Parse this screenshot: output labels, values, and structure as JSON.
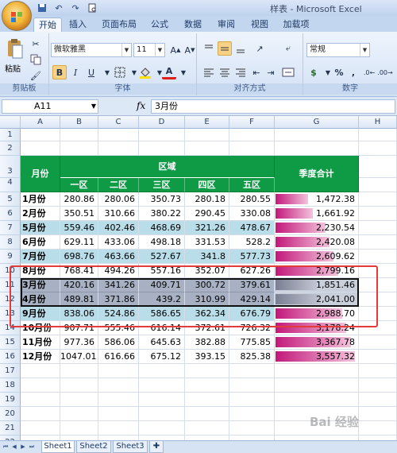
{
  "app": {
    "title": "样表 - Microsoft Excel"
  },
  "qat": {
    "save_icon": "save-icon",
    "undo_icon": "undo-icon",
    "redo_icon": "redo-icon",
    "preview_icon": "print-preview-icon"
  },
  "ribbon": {
    "tabs": [
      "开始",
      "插入",
      "页面布局",
      "公式",
      "数据",
      "审阅",
      "视图",
      "加载项"
    ],
    "groups": {
      "clipboard": "剪贴板",
      "font": "字体",
      "alignment": "对齐方式",
      "number": "数字"
    },
    "paste_label": "粘贴",
    "font_name": "微软雅黑",
    "font_size": "11",
    "number_format": "常规",
    "bold": "B",
    "italic": "I",
    "underline": "U",
    "font_color_letter": "A",
    "currency": "$",
    "percent": "%",
    "comma": ","
  },
  "formula_bar": {
    "name_box": "A11",
    "fx": "fx",
    "content": "3月份"
  },
  "sheet": {
    "columns": [
      "A",
      "B",
      "C",
      "D",
      "E",
      "F",
      "G",
      "H"
    ],
    "rows": [
      "1",
      "2",
      "3",
      "4",
      "5",
      "6",
      "7",
      "8",
      "9",
      "10",
      "11",
      "12",
      "13",
      "14",
      "15",
      "16",
      "17",
      "18",
      "19",
      "20",
      "21",
      "22"
    ],
    "header": {
      "month": "月份",
      "region": "区域",
      "total": "季度合计",
      "sub": [
        "一区",
        "二区",
        "三区",
        "四区",
        "五区"
      ]
    },
    "data": [
      {
        "month": "1月份",
        "v": [
          "280.86",
          "280.06",
          "350.73",
          "280.18",
          "280.55"
        ],
        "total": "1,472.38",
        "tv": 1472.38,
        "style": "white"
      },
      {
        "month": "2月份",
        "v": [
          "350.51",
          "310.66",
          "380.22",
          "290.45",
          "330.08"
        ],
        "total": "1,661.92",
        "tv": 1661.92,
        "style": "white"
      },
      {
        "month": "5月份",
        "v": [
          "559.46",
          "402.46",
          "468.69",
          "321.26",
          "478.67"
        ],
        "total": "2,230.54",
        "tv": 2230.54,
        "style": "blue"
      },
      {
        "month": "6月份",
        "v": [
          "629.11",
          "433.06",
          "498.18",
          "331.53",
          "528.2"
        ],
        "total": "2,420.08",
        "tv": 2420.08,
        "style": "white"
      },
      {
        "month": "7月份",
        "v": [
          "698.76",
          "463.66",
          "527.67",
          "341.8",
          "577.73"
        ],
        "total": "2,609.62",
        "tv": 2609.62,
        "style": "blue"
      },
      {
        "month": "8月份",
        "v": [
          "768.41",
          "494.26",
          "557.16",
          "352.07",
          "627.26"
        ],
        "total": "2,799.16",
        "tv": 2799.16,
        "style": "white"
      },
      {
        "month": "3月份",
        "v": [
          "420.16",
          "341.26",
          "409.71",
          "300.72",
          "379.61"
        ],
        "total": "1,851.46",
        "tv": 1851.46,
        "style": "sel"
      },
      {
        "month": "4月份",
        "v": [
          "489.81",
          "371.86",
          "439.2",
          "310.99",
          "429.14"
        ],
        "total": "2,041.00",
        "tv": 2041.0,
        "style": "sel"
      },
      {
        "month": "9月份",
        "v": [
          "838.06",
          "524.86",
          "586.65",
          "362.34",
          "676.79"
        ],
        "total": "2,988.70",
        "tv": 2988.7,
        "style": "blue"
      },
      {
        "month": "10月份",
        "v": [
          "907.71",
          "555.46",
          "616.14",
          "372.61",
          "726.32"
        ],
        "total": "3,178.24",
        "tv": 3178.24,
        "style": "white"
      },
      {
        "month": "11月份",
        "v": [
          "977.36",
          "586.06",
          "645.63",
          "382.88",
          "775.85"
        ],
        "total": "3,367.78",
        "tv": 3367.78,
        "style": "white"
      },
      {
        "month": "12月份",
        "v": [
          "1047.01",
          "616.66",
          "675.12",
          "393.15",
          "825.38"
        ],
        "total": "3,557.32",
        "tv": 3557.32,
        "style": "white"
      }
    ]
  },
  "sheet_tabs": [
    "Sheet1",
    "Sheet2",
    "Sheet3"
  ],
  "watermark": "Bai 经验",
  "colors": {
    "header_green": "#0f9b46",
    "band_blue": "#b9dde9",
    "selected_gray": "#a7b1c3",
    "databar": "#c2187a",
    "red_frame": "#e33a3a"
  }
}
